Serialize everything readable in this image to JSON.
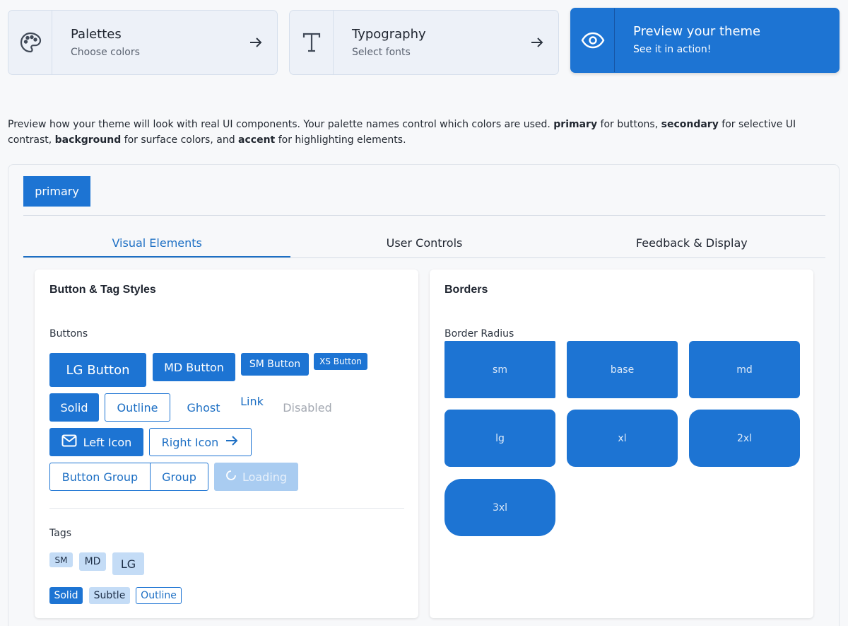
{
  "steps": [
    {
      "title": "Palettes",
      "subtitle": "Choose colors",
      "icon": "palette-icon"
    },
    {
      "title": "Typography",
      "subtitle": "Select fonts",
      "icon": "type-icon"
    },
    {
      "title": "Preview your theme",
      "subtitle": "See it in action!",
      "icon": "eye-icon"
    }
  ],
  "intro": {
    "p1": "Preview how your theme will look with real UI components. Your palette names control which colors are used. ",
    "k_primary": "primary",
    "p2": " for buttons, ",
    "k_secondary": "secondary",
    "p3": " for selective UI contrast, ",
    "k_background": "background",
    "p4": " for surface colors, and ",
    "k_accent": "accent",
    "p5": " for highlighting elements."
  },
  "palette_tab": "primary",
  "tabs": [
    "Visual Elements",
    "User Controls",
    "Feedback & Display"
  ],
  "buttons_card": {
    "title": "Button & Tag Styles",
    "buttons_label": "Buttons",
    "sizes": [
      "LG Button",
      "MD Button",
      "SM Button",
      "XS Button"
    ],
    "variants": [
      "Solid",
      "Outline",
      "Ghost",
      "Link",
      "Disabled"
    ],
    "left_icon": "Left Icon",
    "right_icon": "Right Icon",
    "group": [
      "Button Group",
      "Group"
    ],
    "loading": "Loading",
    "tags_label": "Tags",
    "tag_sizes": [
      "SM",
      "MD",
      "LG"
    ],
    "tag_variants": [
      "Solid",
      "Subtle",
      "Outline"
    ]
  },
  "borders_card": {
    "title": "Borders",
    "radius_label": "Border Radius",
    "radii": [
      "sm",
      "base",
      "md",
      "lg",
      "xl",
      "2xl",
      "3xl"
    ]
  },
  "colors": {
    "primary": "#1d74d3",
    "primary_light": "#c4dcf6",
    "loading": "#a9ccf1"
  }
}
